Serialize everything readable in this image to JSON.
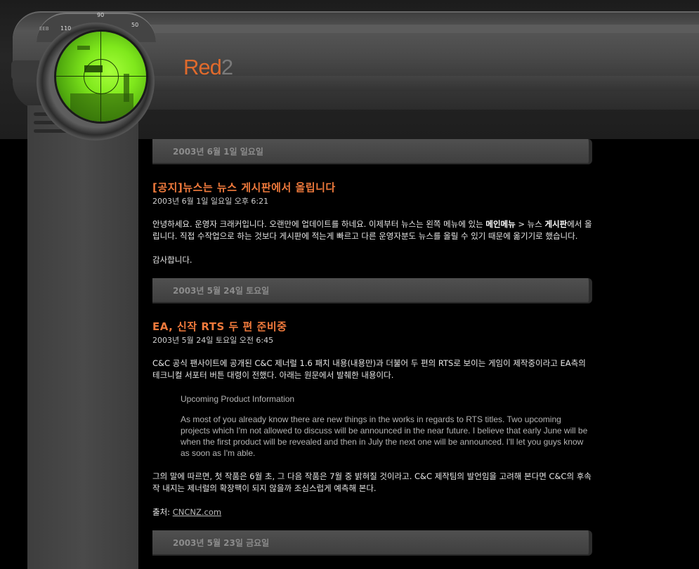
{
  "header": {
    "title_main": "Red",
    "title_suffix": "2",
    "scope_ticks": [
      "110",
      "90",
      "50"
    ],
    "scope_label": "ЕЕВ"
  },
  "posts": [
    {
      "date_bar": "2003년 6월 1일 일요일",
      "title": "[공지]뉴스는 뉴스 게시판에서 올립니다",
      "timestamp": "2003년 6월 1일 일요일 오후 6:21",
      "p1_a": "안녕하세요. 운영자 크래커입니다. 오랜만에 업데이트를 하네요. 이제부터 뉴스는 왼쪽 메뉴에 있는 ",
      "p1_bold1": "메인메뉴",
      "p1_b": " > 뉴스 ",
      "p1_bold2": "게시판",
      "p1_c": "에서 올립니다. 직접 수작업으로 하는 것보다 게시판에 적는게 빠르고 다른 운영자분도 뉴스를 올릴 수 있기 때문에 옮기기로 했습니다.",
      "p2": "감사합니다."
    },
    {
      "date_bar": "2003년 5월 24일 토요일",
      "title": "EA, 신작 RTS 두 편 준비중",
      "timestamp": "2003년 5월 24일 토요일 오전 6:45",
      "p1": "C&C 공식 팬사이트에 공개된 C&C 제너럴 1.6 패치 내용(내용만)과 더불어 두 편의 RTS로 보이는 게임이 제작중이라고 EA측의 테크니컬 서포터 버튼 대령이 전했다. 아래는 원문에서 발췌한 내용이다.",
      "quote_title": "Upcoming Product Information",
      "quote_body": "As most of you already know there are new things in the works in regards to RTS titles. Two upcoming projects which I'm not allowed to discuss will be announced in the near future. I believe that early June will be when the first product will be revealed and then in July the next one will be announced. I'll let you guys know as soon as I'm able.",
      "p2": "그의 말에 따르면, 첫 작품은 6월 초, 그 다음 작품은 7월 중 밝혀질 것이라고. C&C 제작팀의 발언임을 고려해 본다면 C&C의 후속작 내지는 제너럴의 확장팩이 되지 않을까 조심스럽게 예측해 본다.",
      "source_label": "출처: ",
      "source_link": "CNCNZ.com"
    },
    {
      "date_bar": "2003년 5월 23일 금요일"
    }
  ]
}
